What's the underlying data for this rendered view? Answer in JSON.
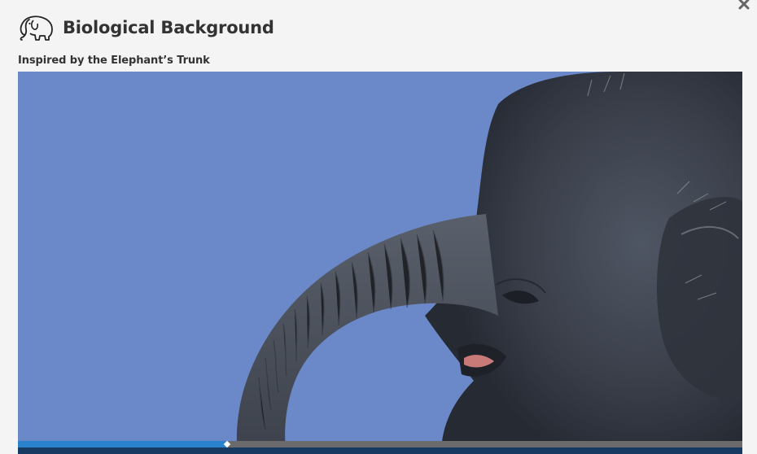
{
  "dialog": {
    "title": "Biological Background",
    "subtitle": "Inspired by the Elephant’s Trunk",
    "logo_icon": "elephant-icon",
    "close_icon": "close-icon"
  },
  "video": {
    "description_icon": "elephant-video-frame",
    "background_color": "#6b89c9",
    "progress": 0.289,
    "progress_color": "#2b82cc",
    "track_color": "#6b6b6b",
    "controls_color": "#173a63"
  }
}
